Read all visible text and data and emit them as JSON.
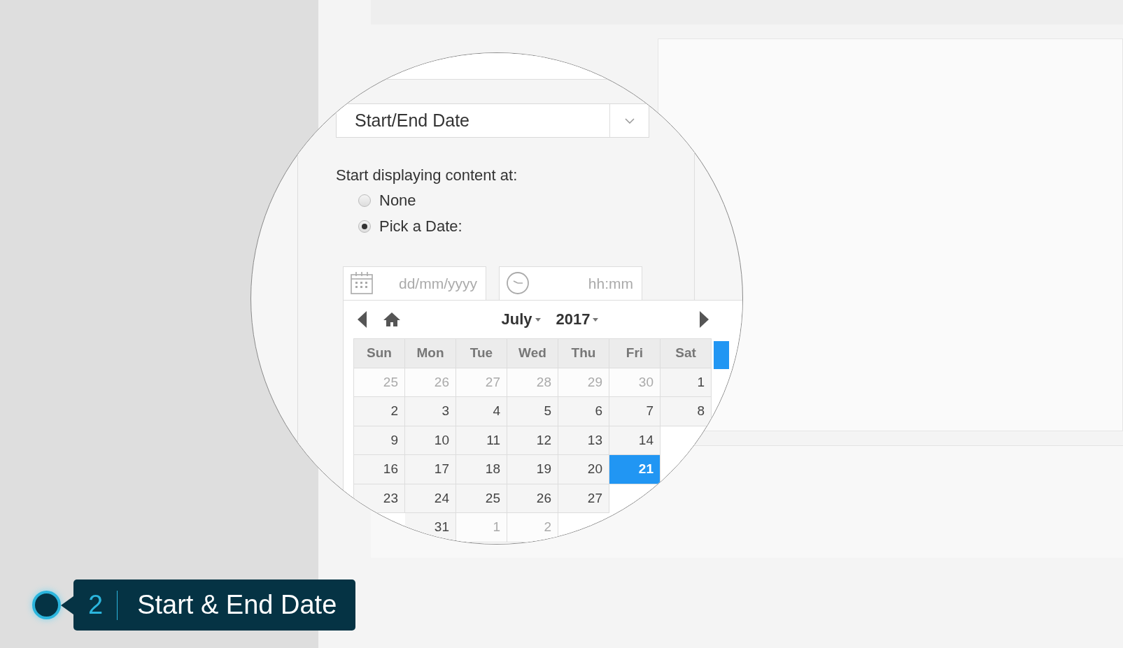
{
  "select": {
    "value": "Start/End Date"
  },
  "start_label": "Start displaying content at:",
  "radios": [
    {
      "label": "None",
      "selected": false
    },
    {
      "label": "Pick a Date:",
      "selected": true
    }
  ],
  "date_field": {
    "placeholder": "dd/mm/yyyy"
  },
  "time_field": {
    "placeholder": "hh:mm"
  },
  "calendar": {
    "month": "July",
    "year": "2017",
    "weekdays": [
      "Sun",
      "Mon",
      "Tue",
      "Wed",
      "Thu",
      "Fri",
      "Sat"
    ],
    "day_columns": [
      [
        {
          "day": "25",
          "muted": true,
          "selected": false
        },
        {
          "day": "2",
          "muted": false,
          "selected": false
        },
        {
          "day": "9",
          "muted": false,
          "selected": false
        },
        {
          "day": "16",
          "muted": false,
          "selected": false
        },
        {
          "day": "23",
          "muted": false,
          "selected": false
        }
      ],
      [
        {
          "day": "26",
          "muted": true,
          "selected": false
        },
        {
          "day": "3",
          "muted": false,
          "selected": false
        },
        {
          "day": "10",
          "muted": false,
          "selected": false
        },
        {
          "day": "17",
          "muted": false,
          "selected": false
        },
        {
          "day": "24",
          "muted": false,
          "selected": false
        },
        {
          "day": "31",
          "muted": false,
          "selected": false
        }
      ],
      [
        {
          "day": "27",
          "muted": true,
          "selected": false
        },
        {
          "day": "4",
          "muted": false,
          "selected": false
        },
        {
          "day": "11",
          "muted": false,
          "selected": false
        },
        {
          "day": "18",
          "muted": false,
          "selected": false
        },
        {
          "day": "25",
          "muted": false,
          "selected": false
        },
        {
          "day": "1",
          "muted": true,
          "selected": false
        }
      ],
      [
        {
          "day": "28",
          "muted": true,
          "selected": false
        },
        {
          "day": "5",
          "muted": false,
          "selected": false
        },
        {
          "day": "12",
          "muted": false,
          "selected": false
        },
        {
          "day": "19",
          "muted": false,
          "selected": false
        },
        {
          "day": "26",
          "muted": false,
          "selected": false
        },
        {
          "day": "2",
          "muted": true,
          "selected": false
        }
      ],
      [
        {
          "day": "29",
          "muted": true,
          "selected": false
        },
        {
          "day": "6",
          "muted": false,
          "selected": false
        },
        {
          "day": "13",
          "muted": false,
          "selected": false
        },
        {
          "day": "20",
          "muted": false,
          "selected": false
        },
        {
          "day": "27",
          "muted": false,
          "selected": false
        }
      ],
      [
        {
          "day": "30",
          "muted": true,
          "selected": false
        },
        {
          "day": "7",
          "muted": false,
          "selected": false
        },
        {
          "day": "14",
          "muted": false,
          "selected": false
        },
        {
          "day": "21",
          "muted": false,
          "selected": true
        }
      ],
      [
        {
          "day": "1",
          "muted": false,
          "selected": false
        },
        {
          "day": "8",
          "muted": false,
          "selected": false
        }
      ]
    ]
  },
  "callout": {
    "number": "2",
    "title": "Start & End Date"
  }
}
